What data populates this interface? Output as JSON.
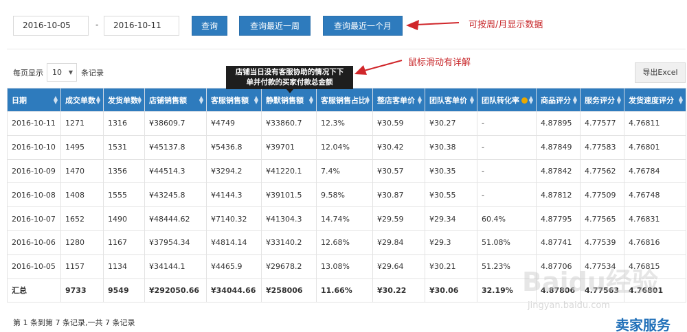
{
  "filters": {
    "start_date": "2016-10-05",
    "separator": "-",
    "end_date": "2016-10-11",
    "btn_query": "查询",
    "btn_week": "查询最近一周",
    "btn_month": "查询最近一个月"
  },
  "annotations": {
    "week_month": "可按周/月显示数据",
    "hover": "鼠标滑动有详解"
  },
  "toolbar": {
    "perpage_prefix": "每页显示",
    "perpage_value": "10",
    "perpage_caret": "▼",
    "perpage_suffix": "条记录",
    "export_label": "导出Excel"
  },
  "tooltip": {
    "line1": "店铺当日没有客服协助的情况下下",
    "line2": "单并付款的买家付款总金额"
  },
  "table": {
    "headers": [
      "日期",
      "成交单数",
      "发货单数",
      "店铺销售额",
      "客服销售额",
      "静默销售额",
      "客服销售占比",
      "整店客单价",
      "团队客单价",
      "团队转化率",
      "商品评分",
      "服务评分",
      "发货速度评分"
    ],
    "rows": [
      [
        "2016-10-11",
        "1271",
        "1316",
        "¥38609.7",
        "¥4749",
        "¥33860.7",
        "12.3%",
        "¥30.59",
        "¥30.27",
        "-",
        "4.87895",
        "4.77577",
        "4.76811"
      ],
      [
        "2016-10-10",
        "1495",
        "1531",
        "¥45137.8",
        "¥5436.8",
        "¥39701",
        "12.04%",
        "¥30.42",
        "¥30.38",
        "-",
        "4.87849",
        "4.77583",
        "4.76801"
      ],
      [
        "2016-10-09",
        "1470",
        "1356",
        "¥44514.3",
        "¥3294.2",
        "¥41220.1",
        "7.4%",
        "¥30.57",
        "¥30.35",
        "-",
        "4.87842",
        "4.77562",
        "4.76784"
      ],
      [
        "2016-10-08",
        "1408",
        "1555",
        "¥43245.8",
        "¥4144.3",
        "¥39101.5",
        "9.58%",
        "¥30.87",
        "¥30.55",
        "-",
        "4.87812",
        "4.77509",
        "4.76748"
      ],
      [
        "2016-10-07",
        "1652",
        "1490",
        "¥48444.62",
        "¥7140.32",
        "¥41304.3",
        "14.74%",
        "¥29.59",
        "¥29.34",
        "60.4%",
        "4.87795",
        "4.77565",
        "4.76831"
      ],
      [
        "2016-10-06",
        "1280",
        "1167",
        "¥37954.34",
        "¥4814.14",
        "¥33140.2",
        "12.68%",
        "¥29.84",
        "¥29.3",
        "51.08%",
        "4.87741",
        "4.77539",
        "4.76816"
      ],
      [
        "2016-10-05",
        "1157",
        "1134",
        "¥34144.1",
        "¥4465.9",
        "¥29678.2",
        "13.08%",
        "¥29.64",
        "¥30.21",
        "51.23%",
        "4.87706",
        "4.77534",
        "4.76815"
      ]
    ],
    "total": [
      "汇总",
      "9733",
      "9549",
      "¥292050.66",
      "¥34044.66",
      "¥258006",
      "11.66%",
      "¥30.22",
      "¥30.06",
      "32.19%",
      "4.87806",
      "4.77563",
      "4.76801"
    ]
  },
  "footer": {
    "summary": "第 1 条到第 7 条记录,一共 7 条记录"
  },
  "watermark": {
    "baidu": "Baidu经验",
    "site": "jingyan.baidu.com",
    "brand": "卖家服务"
  }
}
